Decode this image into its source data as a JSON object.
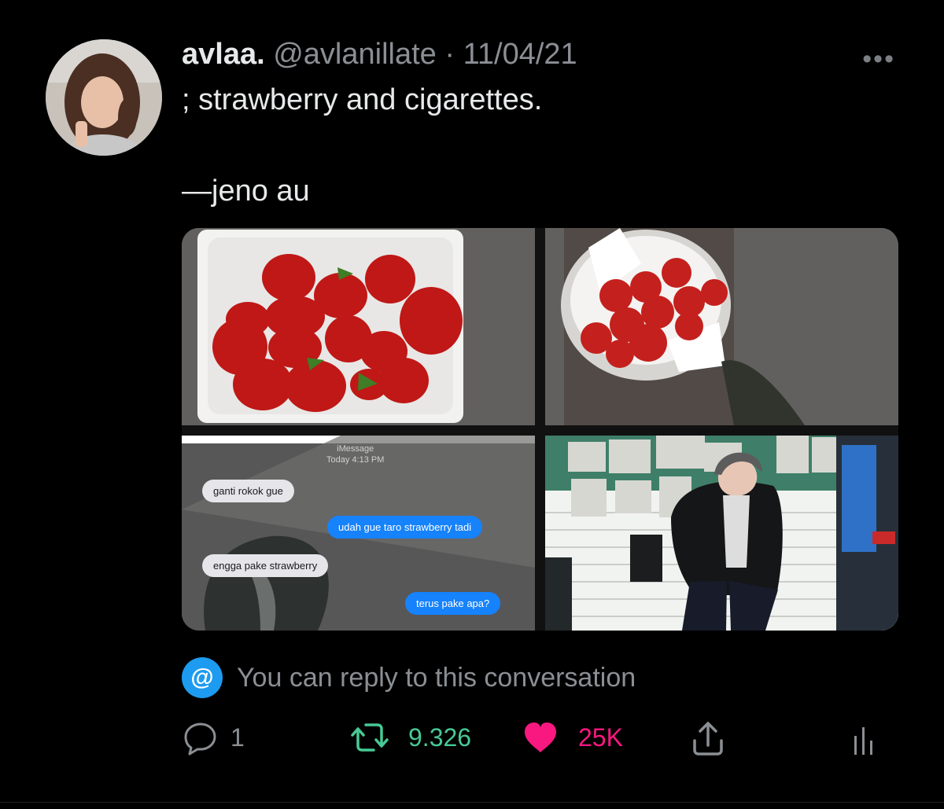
{
  "tweet": {
    "display_name": "avlaa.",
    "handle": "@avlanillate",
    "separator": "·",
    "date": "11/04/21",
    "more_label": "•••",
    "text_line1": "; strawberry and cigarettes.",
    "text_line2": "—jeno au",
    "media": {
      "chat": {
        "service": "iMessage",
        "time": "Today 4:13 PM",
        "messages": [
          {
            "from": "them",
            "text": "ganti rokok gue"
          },
          {
            "from": "me",
            "text": "udah gue taro strawberry tadi"
          },
          {
            "from": "them",
            "text": "engga pake strawberry"
          },
          {
            "from": "me",
            "text": "terus pake apa?"
          }
        ]
      }
    },
    "reply_notice": "You can reply to this conversation",
    "reply_notice_icon": "@",
    "metrics": {
      "replies": "1",
      "retweets": "9.326",
      "likes": "25K"
    },
    "colors": {
      "background": "#000000",
      "retweet": "#48c995",
      "like": "#f91880",
      "accent": "#1d9bf0",
      "muted": "#8b8f94"
    },
    "icons": [
      "reply-icon",
      "retweet-icon",
      "heart-icon",
      "share-icon",
      "analytics-icon",
      "at-icon"
    ]
  }
}
